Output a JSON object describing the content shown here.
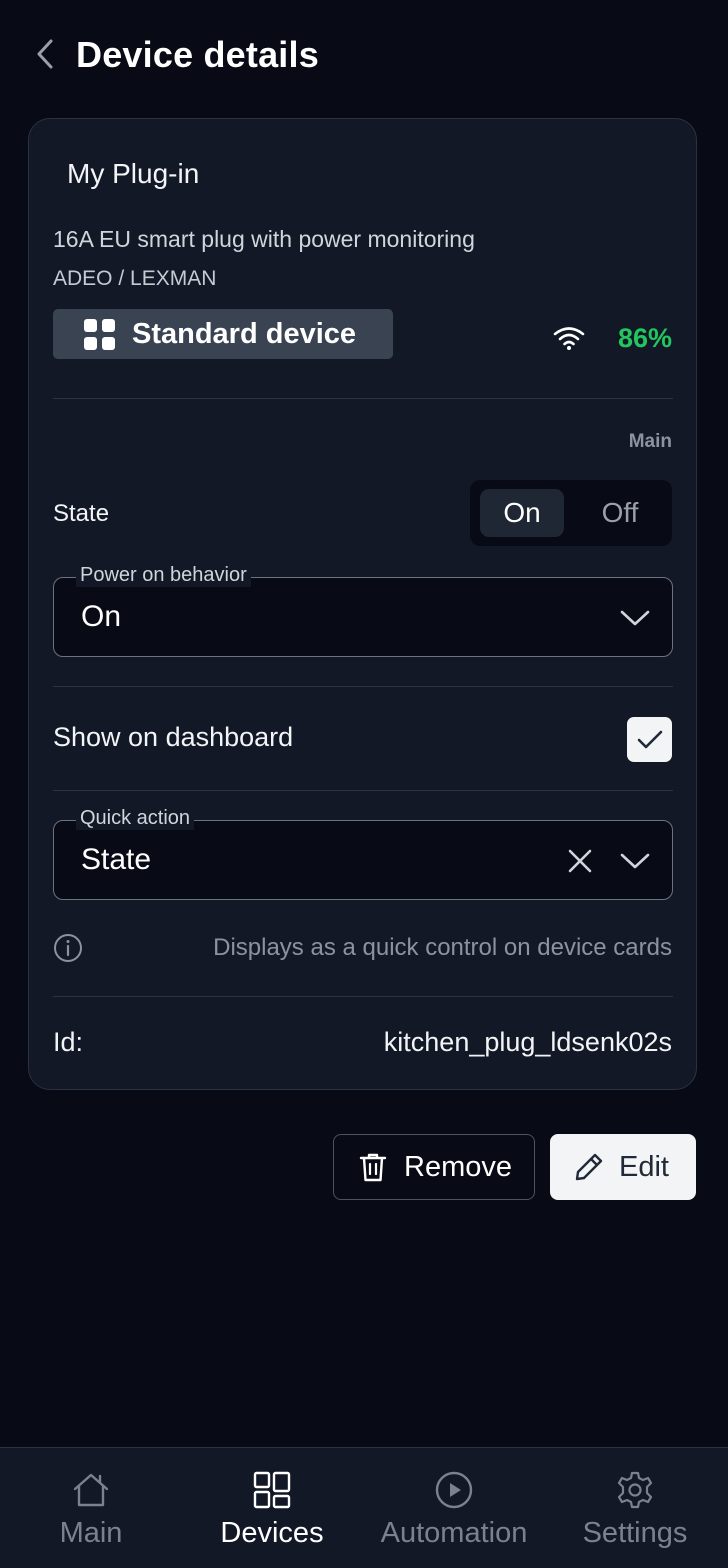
{
  "header": {
    "title": "Device details"
  },
  "device": {
    "name": "My Plug-in",
    "description": "16A EU smart plug with power monitoring",
    "vendor": "ADEO / LEXMAN",
    "type_label": "Standard device",
    "signal": "86%",
    "signal_color": "#22c55e"
  },
  "main_section": {
    "label": "Main",
    "state_label": "State",
    "state_options": [
      "On",
      "Off"
    ],
    "state_selected": "On",
    "power_on_behavior": {
      "legend": "Power on behavior",
      "value": "On"
    }
  },
  "dashboard": {
    "label": "Show on dashboard",
    "checked": true
  },
  "quick_action": {
    "legend": "Quick action",
    "value": "State",
    "hint": "Displays as a quick control on device cards"
  },
  "id_row": {
    "label": "Id:",
    "value": "kitchen_plug_ldsenk02s"
  },
  "actions": {
    "remove_label": "Remove",
    "edit_label": "Edit"
  },
  "nav": {
    "items": [
      {
        "label": "Main",
        "icon": "home-icon",
        "active": false
      },
      {
        "label": "Devices",
        "icon": "devices-grid-icon",
        "active": true
      },
      {
        "label": "Automation",
        "icon": "play-circle-icon",
        "active": false
      },
      {
        "label": "Settings",
        "icon": "gear-icon",
        "active": false
      }
    ]
  }
}
